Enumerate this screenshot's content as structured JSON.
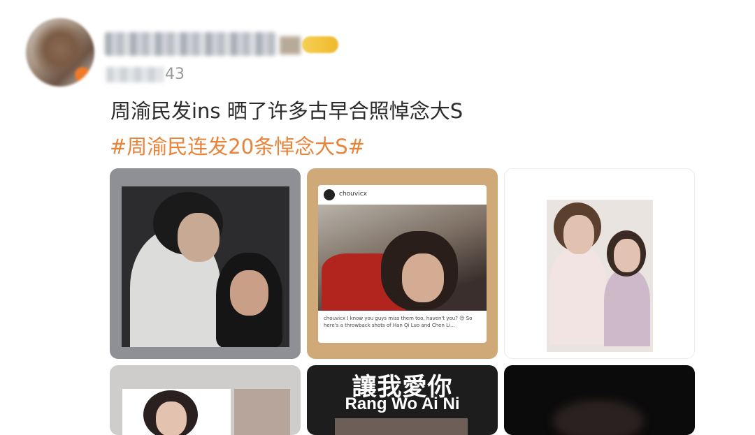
{
  "post": {
    "time_suffix": "43",
    "text": "周渝民发ins 晒了许多古早合照悼念大S",
    "hashtag": "#周渝民连发20条悼念大S#"
  },
  "images": {
    "p2_ig_user": "chouvicx",
    "p2_caption": "chouvicx I know you guys miss them too, haven't you? 😊 So here's a throwback shots of Han Qi Luo and Chen Li...",
    "p5_title_cn": "讓我愛你",
    "p5_title_en": "Rang Wo Ai Ni"
  },
  "colors": {
    "hashtag": "#e8833a",
    "text": "#2b2b2b",
    "timestamp": "#9a9a9a"
  }
}
